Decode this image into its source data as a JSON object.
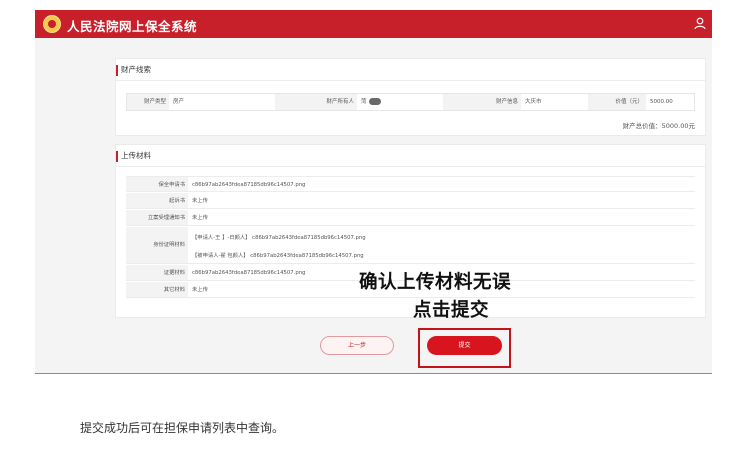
{
  "header": {
    "title": "人民法院网上保全系统",
    "logo_icon": "court-emblem-icon",
    "user_icon": "user-icon"
  },
  "property": {
    "section_title": "财产线索",
    "type_label": "财产类型",
    "type_value": "房产",
    "owner_label": "财产所有人",
    "owner_value": "菏",
    "info_label": "财产信息",
    "info_value": "大庆市",
    "price_label": "价值（元）",
    "price_value": "5000.00",
    "total": "财产总价值：5000.00元"
  },
  "materials": {
    "section_title": "上传材料",
    "rows": [
      {
        "label": "保全申请书",
        "value": "c86b97ab2643fdea87185db96c14507.png"
      },
      {
        "label": "起诉书",
        "value": "未上传"
      },
      {
        "label": "立案受理通知书",
        "value": "未上传"
      },
      {
        "label": "身份证明材料",
        "value1": "【申请人-王  】-日颜人】 c86b97ab2643fdea87185db96c14507.png",
        "value2": "【被申请人-翟    包颜人】 c86b97ab2643fdea87185db96c14507.png"
      },
      {
        "label": "证据材料",
        "value": "c86b97ab2643fdea87185db96c14507.png"
      },
      {
        "label": "其它材料",
        "value": "未上传"
      }
    ]
  },
  "overlay": {
    "line1": "确认上传材料无误",
    "line2": "点击提交"
  },
  "buttons": {
    "prev": "上一步",
    "submit": "提交"
  },
  "caption": "提交成功后可在担保申请列表中查询。",
  "colors": {
    "brand_red": "#c8202a",
    "submit_red": "#d8141e"
  }
}
